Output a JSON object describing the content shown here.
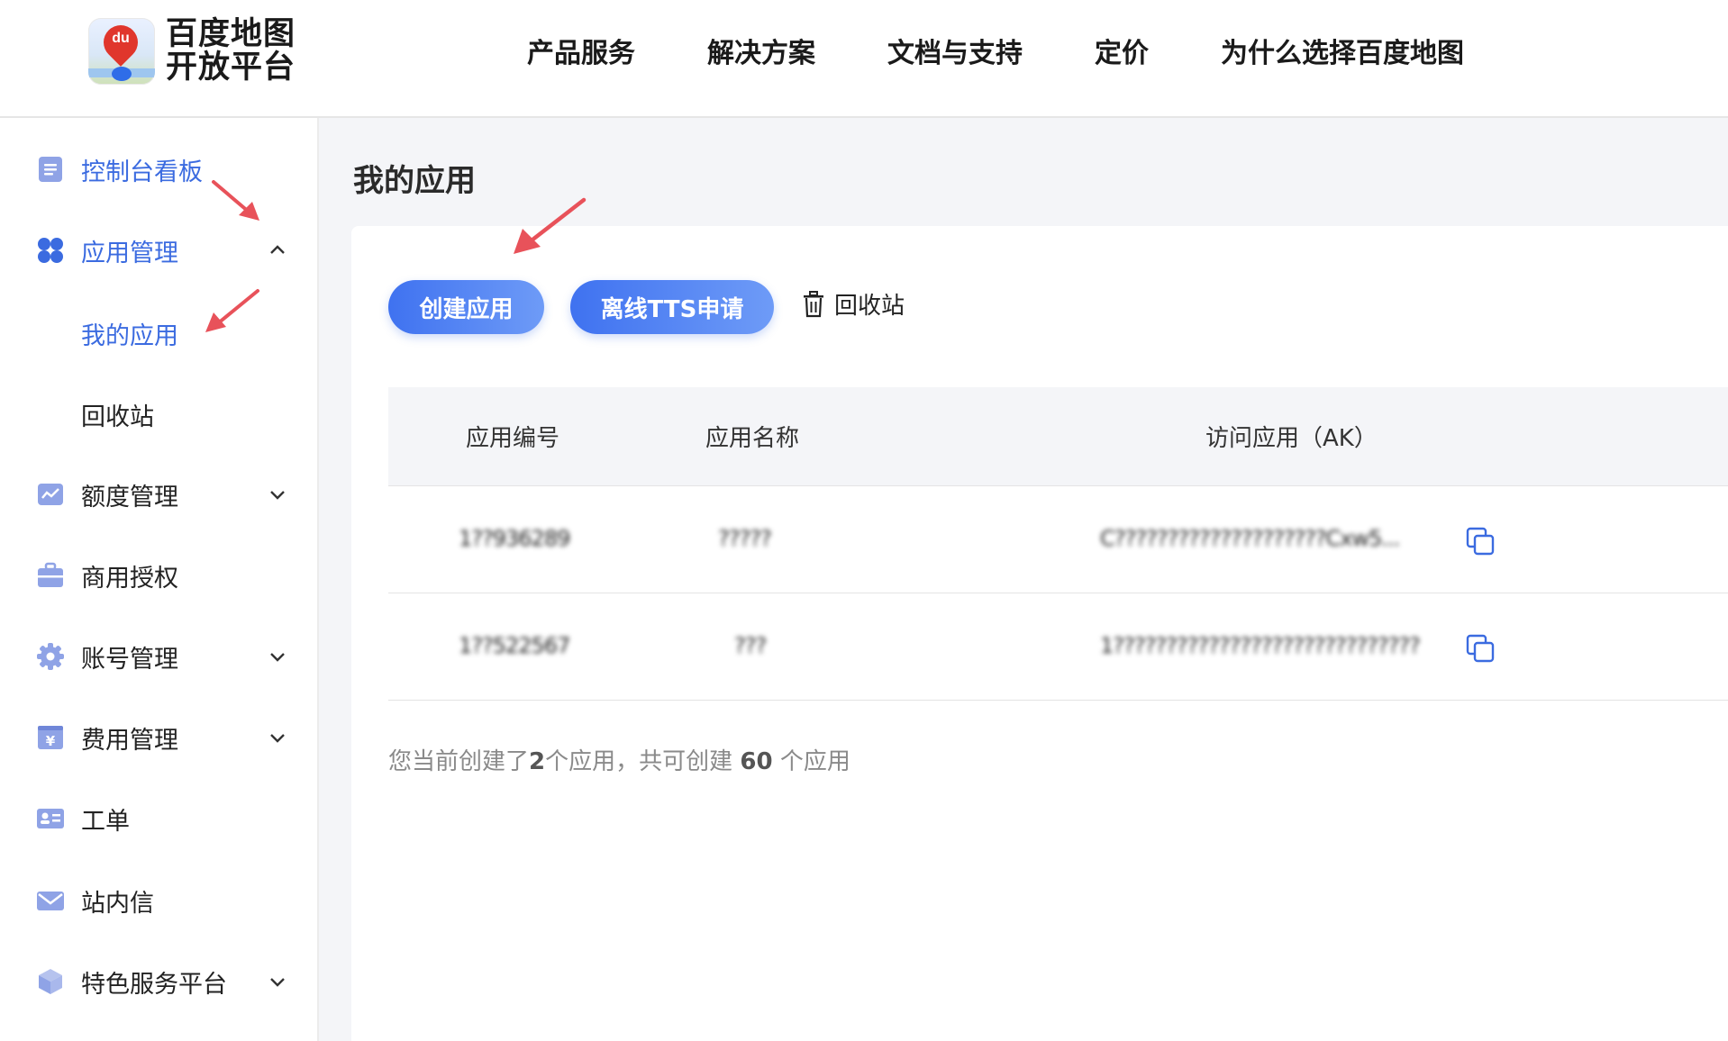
{
  "header": {
    "logo_badge": "du",
    "logo_line1": "百度地图",
    "logo_line2": "开放平台",
    "nav": [
      "产品服务",
      "解决方案",
      "文档与支持",
      "定价",
      "为什么选择百度地图"
    ]
  },
  "sidebar": {
    "items": [
      {
        "label": "控制台看板",
        "icon": "dashboard-icon"
      },
      {
        "label": "应用管理",
        "icon": "apps-grid-icon",
        "expanded": true
      },
      {
        "label": "我的应用",
        "sub": true,
        "active": true
      },
      {
        "label": "回收站",
        "sub": true
      },
      {
        "label": "额度管理",
        "icon": "quota-chart-icon",
        "expandable": true
      },
      {
        "label": "商用授权",
        "icon": "briefcase-icon"
      },
      {
        "label": "账号管理",
        "icon": "gear-icon",
        "expandable": true
      },
      {
        "label": "费用管理",
        "icon": "yuan-bill-icon",
        "expandable": true
      },
      {
        "label": "工单",
        "icon": "id-card-icon"
      },
      {
        "label": "站内信",
        "icon": "mail-icon"
      },
      {
        "label": "特色服务平台",
        "icon": "cube-icon",
        "expandable": true
      }
    ]
  },
  "main": {
    "title": "我的应用",
    "buttons": {
      "create": "创建应用",
      "tts": "离线TTS申请",
      "recycle": "回收站"
    },
    "table": {
      "headers": [
        "应用编号",
        "应用名称",
        "访问应用（AK）"
      ],
      "rows": [
        {
          "id": "1??936289",
          "name": "?????",
          "ak": "C????????????????????Cxw5..."
        },
        {
          "id": "1??522567",
          "name": "???",
          "ak": "1?????????????????????????????"
        }
      ]
    },
    "summary": {
      "prefix": "您当前创建了",
      "count": "2",
      "middle": "个应用，共可创建",
      "limit": "60",
      "suffix": "个应用"
    }
  },
  "colors": {
    "accent": "#3b6be0",
    "annotation_arrow": "#e8525a",
    "main_bg": "#f4f5f8"
  }
}
